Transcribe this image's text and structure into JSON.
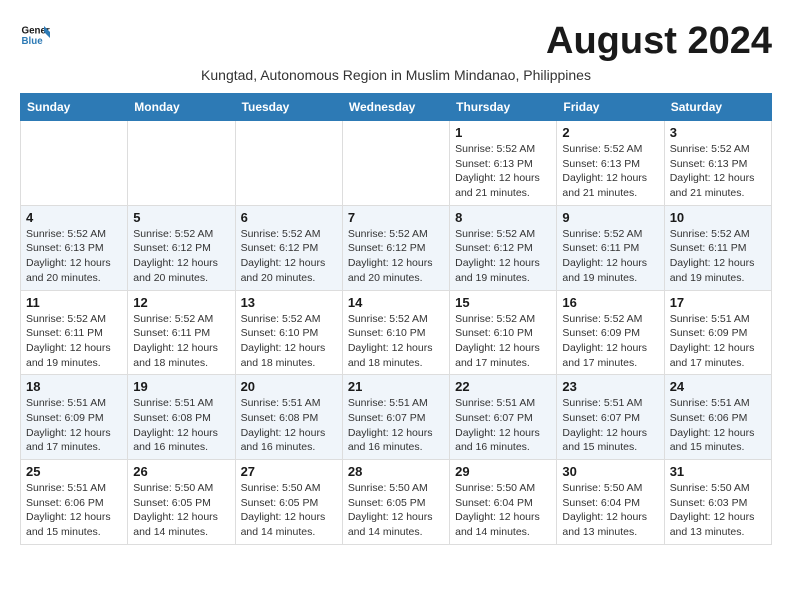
{
  "header": {
    "logo_line1": "General",
    "logo_line2": "Blue",
    "month_year": "August 2024",
    "subtitle": "Kungtad, Autonomous Region in Muslim Mindanao, Philippines"
  },
  "weekdays": [
    "Sunday",
    "Monday",
    "Tuesday",
    "Wednesday",
    "Thursday",
    "Friday",
    "Saturday"
  ],
  "weeks": [
    [
      {
        "day": "",
        "sunrise": "",
        "sunset": "",
        "daylight": ""
      },
      {
        "day": "",
        "sunrise": "",
        "sunset": "",
        "daylight": ""
      },
      {
        "day": "",
        "sunrise": "",
        "sunset": "",
        "daylight": ""
      },
      {
        "day": "",
        "sunrise": "",
        "sunset": "",
        "daylight": ""
      },
      {
        "day": "1",
        "sunrise": "Sunrise: 5:52 AM",
        "sunset": "Sunset: 6:13 PM",
        "daylight": "Daylight: 12 hours and 21 minutes."
      },
      {
        "day": "2",
        "sunrise": "Sunrise: 5:52 AM",
        "sunset": "Sunset: 6:13 PM",
        "daylight": "Daylight: 12 hours and 21 minutes."
      },
      {
        "day": "3",
        "sunrise": "Sunrise: 5:52 AM",
        "sunset": "Sunset: 6:13 PM",
        "daylight": "Daylight: 12 hours and 21 minutes."
      }
    ],
    [
      {
        "day": "4",
        "sunrise": "Sunrise: 5:52 AM",
        "sunset": "Sunset: 6:13 PM",
        "daylight": "Daylight: 12 hours and 20 minutes."
      },
      {
        "day": "5",
        "sunrise": "Sunrise: 5:52 AM",
        "sunset": "Sunset: 6:12 PM",
        "daylight": "Daylight: 12 hours and 20 minutes."
      },
      {
        "day": "6",
        "sunrise": "Sunrise: 5:52 AM",
        "sunset": "Sunset: 6:12 PM",
        "daylight": "Daylight: 12 hours and 20 minutes."
      },
      {
        "day": "7",
        "sunrise": "Sunrise: 5:52 AM",
        "sunset": "Sunset: 6:12 PM",
        "daylight": "Daylight: 12 hours and 20 minutes."
      },
      {
        "day": "8",
        "sunrise": "Sunrise: 5:52 AM",
        "sunset": "Sunset: 6:12 PM",
        "daylight": "Daylight: 12 hours and 19 minutes."
      },
      {
        "day": "9",
        "sunrise": "Sunrise: 5:52 AM",
        "sunset": "Sunset: 6:11 PM",
        "daylight": "Daylight: 12 hours and 19 minutes."
      },
      {
        "day": "10",
        "sunrise": "Sunrise: 5:52 AM",
        "sunset": "Sunset: 6:11 PM",
        "daylight": "Daylight: 12 hours and 19 minutes."
      }
    ],
    [
      {
        "day": "11",
        "sunrise": "Sunrise: 5:52 AM",
        "sunset": "Sunset: 6:11 PM",
        "daylight": "Daylight: 12 hours and 19 minutes."
      },
      {
        "day": "12",
        "sunrise": "Sunrise: 5:52 AM",
        "sunset": "Sunset: 6:11 PM",
        "daylight": "Daylight: 12 hours and 18 minutes."
      },
      {
        "day": "13",
        "sunrise": "Sunrise: 5:52 AM",
        "sunset": "Sunset: 6:10 PM",
        "daylight": "Daylight: 12 hours and 18 minutes."
      },
      {
        "day": "14",
        "sunrise": "Sunrise: 5:52 AM",
        "sunset": "Sunset: 6:10 PM",
        "daylight": "Daylight: 12 hours and 18 minutes."
      },
      {
        "day": "15",
        "sunrise": "Sunrise: 5:52 AM",
        "sunset": "Sunset: 6:10 PM",
        "daylight": "Daylight: 12 hours and 17 minutes."
      },
      {
        "day": "16",
        "sunrise": "Sunrise: 5:52 AM",
        "sunset": "Sunset: 6:09 PM",
        "daylight": "Daylight: 12 hours and 17 minutes."
      },
      {
        "day": "17",
        "sunrise": "Sunrise: 5:51 AM",
        "sunset": "Sunset: 6:09 PM",
        "daylight": "Daylight: 12 hours and 17 minutes."
      }
    ],
    [
      {
        "day": "18",
        "sunrise": "Sunrise: 5:51 AM",
        "sunset": "Sunset: 6:09 PM",
        "daylight": "Daylight: 12 hours and 17 minutes."
      },
      {
        "day": "19",
        "sunrise": "Sunrise: 5:51 AM",
        "sunset": "Sunset: 6:08 PM",
        "daylight": "Daylight: 12 hours and 16 minutes."
      },
      {
        "day": "20",
        "sunrise": "Sunrise: 5:51 AM",
        "sunset": "Sunset: 6:08 PM",
        "daylight": "Daylight: 12 hours and 16 minutes."
      },
      {
        "day": "21",
        "sunrise": "Sunrise: 5:51 AM",
        "sunset": "Sunset: 6:07 PM",
        "daylight": "Daylight: 12 hours and 16 minutes."
      },
      {
        "day": "22",
        "sunrise": "Sunrise: 5:51 AM",
        "sunset": "Sunset: 6:07 PM",
        "daylight": "Daylight: 12 hours and 16 minutes."
      },
      {
        "day": "23",
        "sunrise": "Sunrise: 5:51 AM",
        "sunset": "Sunset: 6:07 PM",
        "daylight": "Daylight: 12 hours and 15 minutes."
      },
      {
        "day": "24",
        "sunrise": "Sunrise: 5:51 AM",
        "sunset": "Sunset: 6:06 PM",
        "daylight": "Daylight: 12 hours and 15 minutes."
      }
    ],
    [
      {
        "day": "25",
        "sunrise": "Sunrise: 5:51 AM",
        "sunset": "Sunset: 6:06 PM",
        "daylight": "Daylight: 12 hours and 15 minutes."
      },
      {
        "day": "26",
        "sunrise": "Sunrise: 5:50 AM",
        "sunset": "Sunset: 6:05 PM",
        "daylight": "Daylight: 12 hours and 14 minutes."
      },
      {
        "day": "27",
        "sunrise": "Sunrise: 5:50 AM",
        "sunset": "Sunset: 6:05 PM",
        "daylight": "Daylight: 12 hours and 14 minutes."
      },
      {
        "day": "28",
        "sunrise": "Sunrise: 5:50 AM",
        "sunset": "Sunset: 6:05 PM",
        "daylight": "Daylight: 12 hours and 14 minutes."
      },
      {
        "day": "29",
        "sunrise": "Sunrise: 5:50 AM",
        "sunset": "Sunset: 6:04 PM",
        "daylight": "Daylight: 12 hours and 14 minutes."
      },
      {
        "day": "30",
        "sunrise": "Sunrise: 5:50 AM",
        "sunset": "Sunset: 6:04 PM",
        "daylight": "Daylight: 12 hours and 13 minutes."
      },
      {
        "day": "31",
        "sunrise": "Sunrise: 5:50 AM",
        "sunset": "Sunset: 6:03 PM",
        "daylight": "Daylight: 12 hours and 13 minutes."
      }
    ]
  ]
}
